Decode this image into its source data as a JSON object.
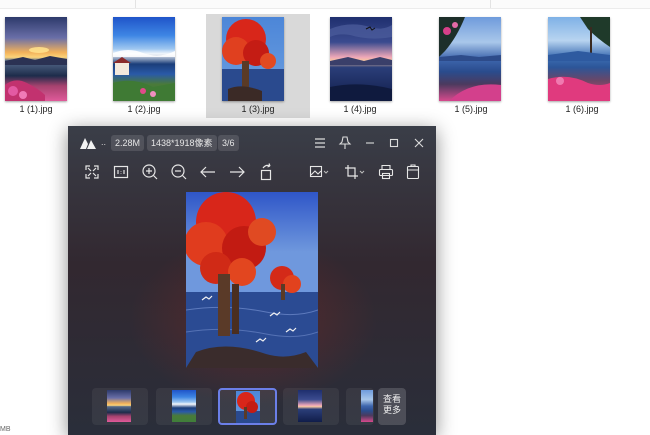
{
  "explorer": {
    "files": [
      {
        "name": "1 (1).jpg",
        "scene": "sunset",
        "selected": false
      },
      {
        "name": "1 (2).jpg",
        "scene": "bay",
        "selected": false
      },
      {
        "name": "1 (3).jpg",
        "scene": "red-tree",
        "selected": true
      },
      {
        "name": "1 (4).jpg",
        "scene": "dusk",
        "selected": false
      },
      {
        "name": "1 (5).jpg",
        "scene": "lake",
        "selected": false
      },
      {
        "name": "1 (6).jpg",
        "scene": "shore",
        "selected": false
      }
    ],
    "status_text": "MB"
  },
  "viewer": {
    "title_ellipsis": "..",
    "file_size": "2.28M",
    "dimensions": "1438*1918像素",
    "position": "3/6",
    "toolbar": [
      "fullscreen-icon",
      "actual-size-icon",
      "zoom-in-icon",
      "zoom-out-icon",
      "previous-arrow-icon",
      "next-arrow-icon",
      "rotate-icon",
      "image-edit-icon",
      "crop-icon",
      "print-icon",
      "delete-icon"
    ],
    "window_buttons": [
      "menu-icon",
      "pin-icon",
      "minimize-icon",
      "maximize-icon",
      "close-icon"
    ],
    "see_more_line1": "查看",
    "see_more_line2": "更多",
    "accent_color": "#6b7fe8"
  }
}
